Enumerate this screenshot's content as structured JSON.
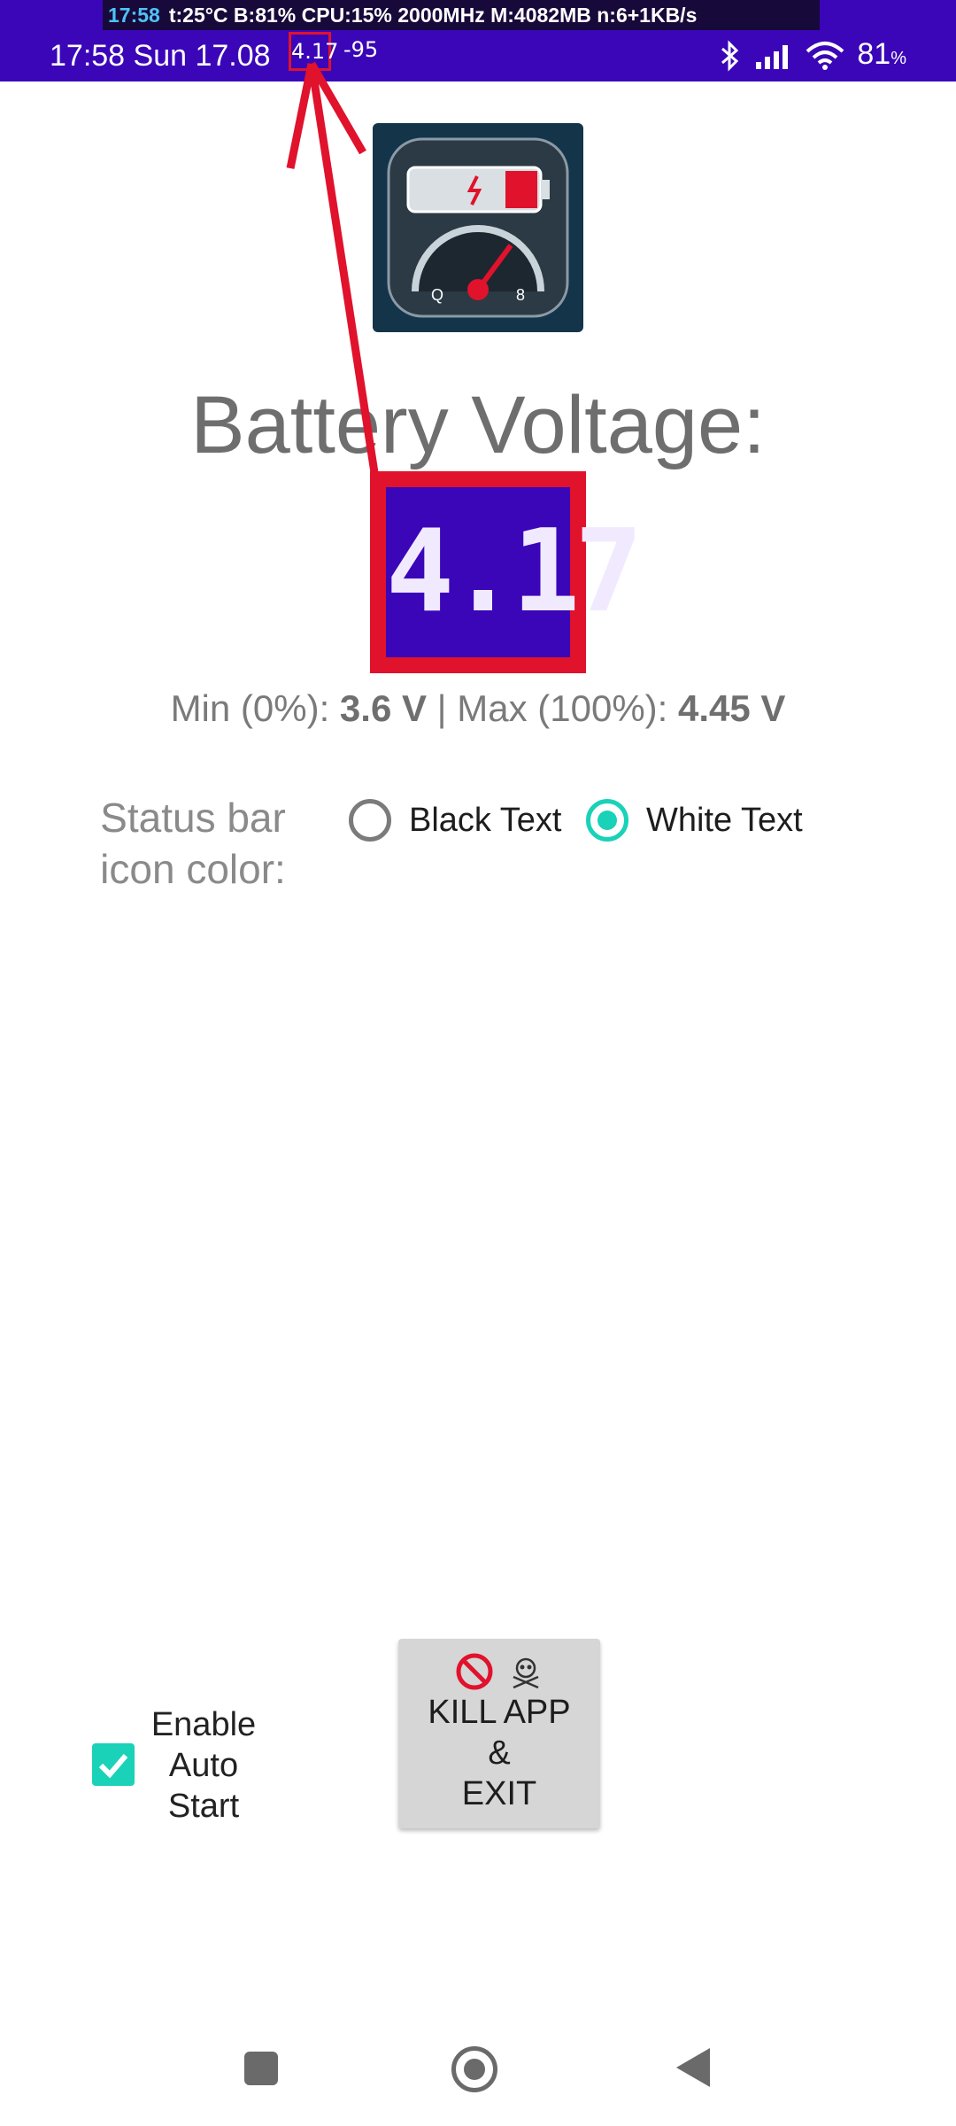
{
  "status_bar": {
    "overlay_time": "17:58",
    "overlay_stats": "t:25°C B:81% CPU:15% 2000MHz M:4082MB n:6+1KB/s",
    "datetime": "17:58 Sun 17.08",
    "voltage_indicator": "4.17",
    "signal_value": "-95",
    "battery_percent": "81",
    "battery_percent_symbol": "%",
    "icons": [
      "bluetooth-icon",
      "cellular-signal-icon",
      "wifi-icon"
    ]
  },
  "main": {
    "title": "Battery Voltage:",
    "voltage_value": "4.17",
    "min_label": "Min (0%): ",
    "min_value": "3.6 V",
    "separator": " | ",
    "max_label": "Max (100%): ",
    "max_value": "4.45 V"
  },
  "status_icon_color": {
    "label": "Status bar icon color:",
    "options": [
      {
        "label": "Black Text",
        "selected": false
      },
      {
        "label": "White Text",
        "selected": true
      }
    ]
  },
  "auto_start": {
    "label": "Enable Auto Start",
    "checked": true
  },
  "kill_button": {
    "icons": [
      "no-entry-icon",
      "skull-crossbones-icon"
    ],
    "line1": "KILL APP",
    "line2": "&",
    "line3": "EXIT"
  },
  "nav_bar": {
    "buttons": [
      "recents-button",
      "home-button",
      "back-button"
    ]
  },
  "colors": {
    "status_bar_bg": "#3a06b8",
    "highlight_red": "#e0122c",
    "accent_teal": "#19d2b8"
  }
}
